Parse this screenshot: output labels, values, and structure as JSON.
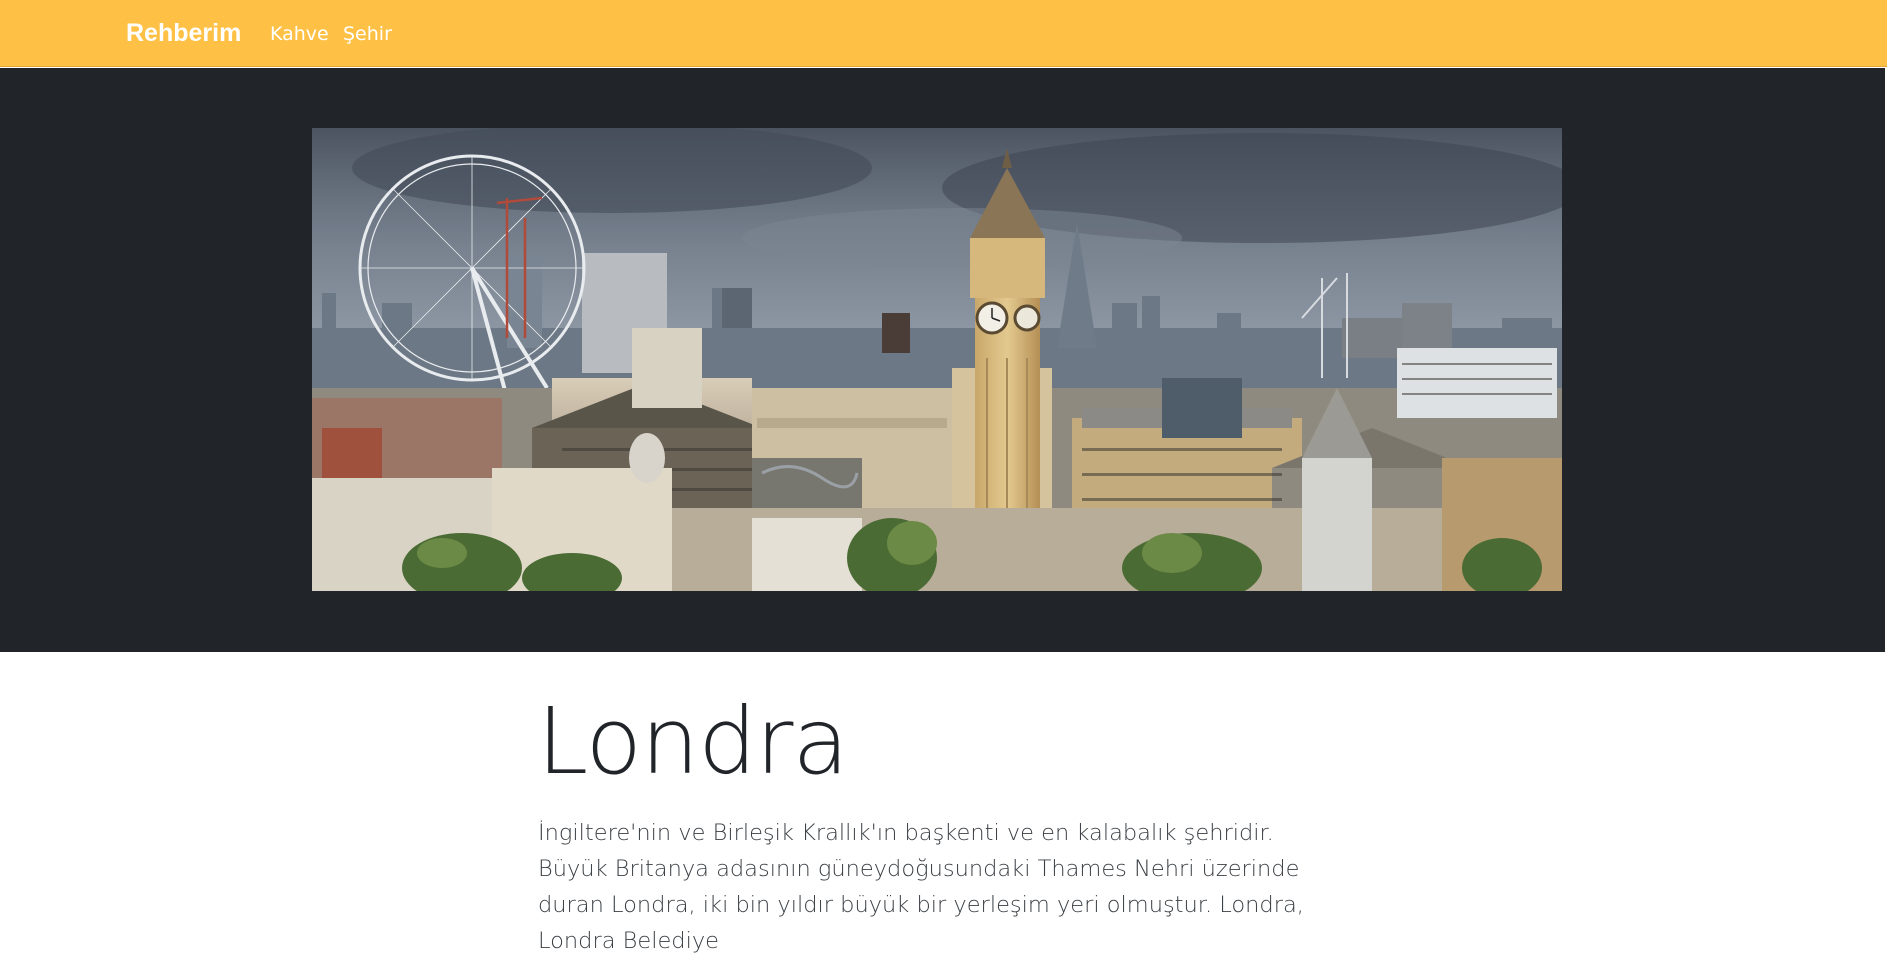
{
  "navbar": {
    "brand": "Rehberim",
    "links": [
      {
        "label": "Kahve"
      },
      {
        "label": "Şehir"
      }
    ],
    "background_color": "#ffc145",
    "text_color": "#ffffff"
  },
  "hero": {
    "background_color": "#212529",
    "image": {
      "icon": "london-skyline-photo",
      "alt": ""
    }
  },
  "article": {
    "title": "Londra",
    "lead": "İngiltere'nin ve Birleşik Krallık'ın başkenti ve en kalabalık şehridir. Büyük Britanya adasının güneydoğusundaki Thames Nehri üzerinde duran Londra, iki bin yıldır büyük bir yerleşim yeri olmuştur. Londra, Londra Belediye"
  }
}
